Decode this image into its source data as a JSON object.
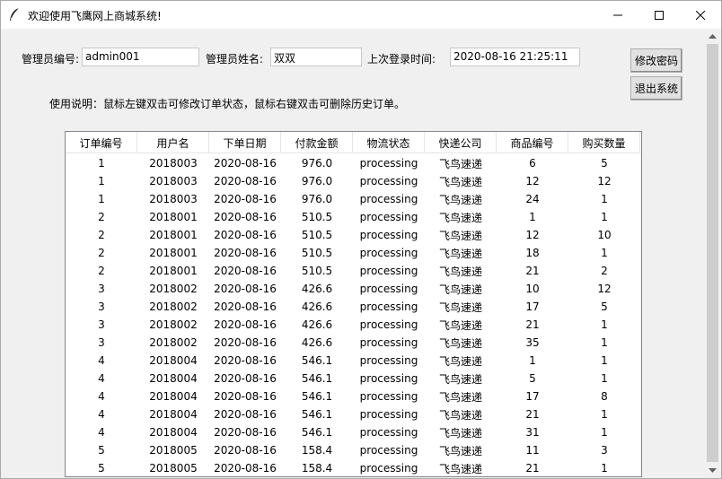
{
  "window": {
    "title": "欢迎使用飞鹰网上商城系统!"
  },
  "admin": {
    "id_label": "管理员编号:",
    "id_value": "admin001",
    "name_label": "管理员姓名:",
    "name_value": "双双",
    "last_login_label": "上次登录时间:",
    "last_login_value": "2020-08-16 21:25:11"
  },
  "buttons": {
    "change_password": "修改密码",
    "exit_system": "退出系统"
  },
  "instructions": "使用说明：鼠标左键双击可修改订单状态，鼠标右键双击可删除历史订单。",
  "table": {
    "columns": [
      "订单编号",
      "用户名",
      "下单日期",
      "付款金额",
      "物流状态",
      "快递公司",
      "商品编号",
      "购买数量"
    ],
    "rows": [
      [
        "1",
        "2018003",
        "2020-08-16",
        "976.0",
        "processing",
        "飞鸟速递",
        "6",
        "5"
      ],
      [
        "1",
        "2018003",
        "2020-08-16",
        "976.0",
        "processing",
        "飞鸟速递",
        "12",
        "12"
      ],
      [
        "1",
        "2018003",
        "2020-08-16",
        "976.0",
        "processing",
        "飞鸟速递",
        "24",
        "1"
      ],
      [
        "2",
        "2018001",
        "2020-08-16",
        "510.5",
        "processing",
        "飞鸟速递",
        "1",
        "1"
      ],
      [
        "2",
        "2018001",
        "2020-08-16",
        "510.5",
        "processing",
        "飞鸟速递",
        "12",
        "10"
      ],
      [
        "2",
        "2018001",
        "2020-08-16",
        "510.5",
        "processing",
        "飞鸟速递",
        "18",
        "1"
      ],
      [
        "2",
        "2018001",
        "2020-08-16",
        "510.5",
        "processing",
        "飞鸟速递",
        "21",
        "2"
      ],
      [
        "3",
        "2018002",
        "2020-08-16",
        "426.6",
        "processing",
        "飞鸟速递",
        "10",
        "12"
      ],
      [
        "3",
        "2018002",
        "2020-08-16",
        "426.6",
        "processing",
        "飞鸟速递",
        "17",
        "5"
      ],
      [
        "3",
        "2018002",
        "2020-08-16",
        "426.6",
        "processing",
        "飞鸟速递",
        "21",
        "1"
      ],
      [
        "3",
        "2018002",
        "2020-08-16",
        "426.6",
        "processing",
        "飞鸟速递",
        "35",
        "1"
      ],
      [
        "4",
        "2018004",
        "2020-08-16",
        "546.1",
        "processing",
        "飞鸟速递",
        "1",
        "1"
      ],
      [
        "4",
        "2018004",
        "2020-08-16",
        "546.1",
        "processing",
        "飞鸟速递",
        "5",
        "1"
      ],
      [
        "4",
        "2018004",
        "2020-08-16",
        "546.1",
        "processing",
        "飞鸟速递",
        "17",
        "8"
      ],
      [
        "4",
        "2018004",
        "2020-08-16",
        "546.1",
        "processing",
        "飞鸟速递",
        "21",
        "1"
      ],
      [
        "4",
        "2018004",
        "2020-08-16",
        "546.1",
        "processing",
        "飞鸟速递",
        "31",
        "1"
      ],
      [
        "5",
        "2018005",
        "2020-08-16",
        "158.4",
        "processing",
        "飞鸟速递",
        "11",
        "3"
      ],
      [
        "5",
        "2018005",
        "2020-08-16",
        "158.4",
        "processing",
        "飞鸟速递",
        "21",
        "1"
      ]
    ]
  }
}
